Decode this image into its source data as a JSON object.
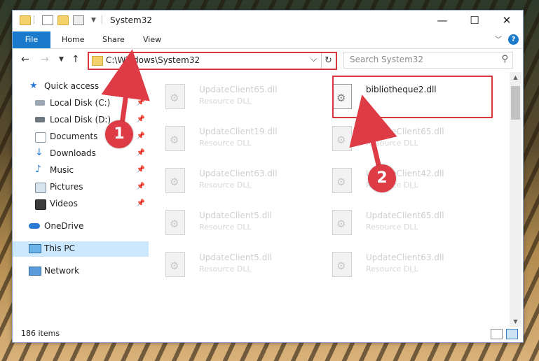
{
  "window": {
    "title": "System32",
    "minimize_glyph": "—",
    "maximize_glyph": "☐",
    "close_glyph": "✕"
  },
  "ribbon": {
    "tabs": [
      {
        "label": "File"
      },
      {
        "label": "Home"
      },
      {
        "label": "Share"
      },
      {
        "label": "View"
      }
    ],
    "help_glyph": "?"
  },
  "navigation": {
    "address_path": "C:\\Windows\\System32",
    "search_placeholder": "Search System32"
  },
  "sidebar": {
    "items": [
      {
        "label": "Quick access",
        "icon": "star-icon"
      },
      {
        "label": "Local Disk (C:)",
        "icon": "drive-icon"
      },
      {
        "label": "Local Disk (D:)",
        "icon": "drive-icon"
      },
      {
        "label": "Documents",
        "icon": "documents-icon"
      },
      {
        "label": "Downloads",
        "icon": "download-icon"
      },
      {
        "label": "Music",
        "icon": "music-icon"
      },
      {
        "label": "Pictures",
        "icon": "pictures-icon"
      },
      {
        "label": "Videos",
        "icon": "videos-icon"
      },
      {
        "label": "OneDrive",
        "icon": "cloud-icon"
      },
      {
        "label": "This PC",
        "icon": "computer-icon"
      },
      {
        "label": "Network",
        "icon": "network-icon"
      }
    ],
    "selected": "This PC"
  },
  "files": [
    {
      "name": "UpdateClient65.dll",
      "type": "Resource DLL"
    },
    {
      "name": "bibliotheque2.dll",
      "type": ""
    },
    {
      "name": "UpdateClient19.dll",
      "type": "Resource DLL"
    },
    {
      "name": "UpdateClient65.dll",
      "type": "Resource DLL"
    },
    {
      "name": "UpdateClient63.dll",
      "type": "Resource DLL"
    },
    {
      "name": "UpdateClient42.dll",
      "type": "Resource DLL"
    },
    {
      "name": "UpdateClient5.dll",
      "type": "Resource DLL"
    },
    {
      "name": "UpdateClient65.dll",
      "type": "Resource DLL"
    },
    {
      "name": "UpdateClient5.dll",
      "type": "Resource DLL"
    },
    {
      "name": "UpdateClient63.dll",
      "type": "Resource DLL"
    }
  ],
  "status": {
    "item_count": "186 items"
  },
  "annotations": {
    "step1": "1",
    "step2": "2",
    "color": "#dd3b45"
  }
}
